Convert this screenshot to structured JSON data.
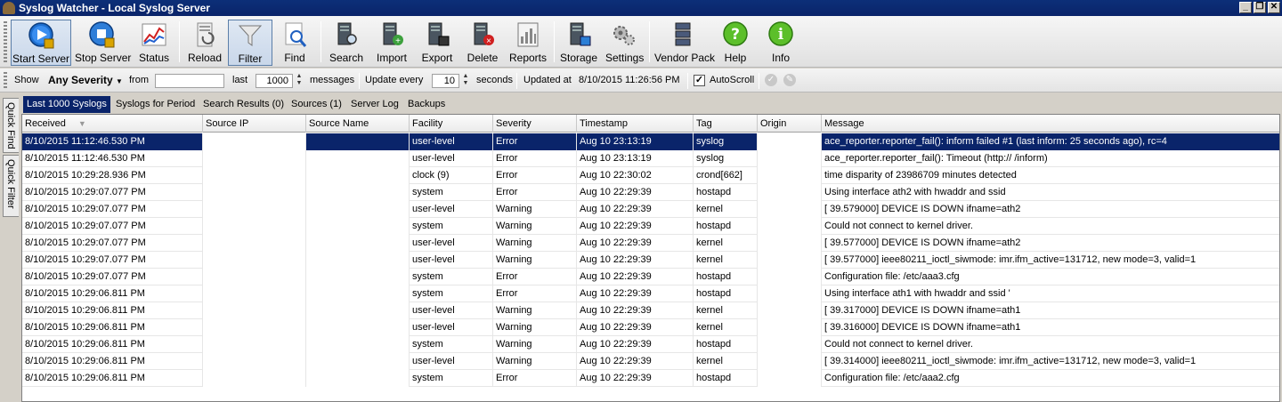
{
  "window": {
    "title": "Syslog Watcher - Local Syslog Server"
  },
  "toolbar": {
    "buttons": [
      {
        "label": "Start Server",
        "icon": "play-server-icon"
      },
      {
        "label": "Stop Server",
        "icon": "stop-server-icon"
      },
      {
        "label": "Status",
        "icon": "chart-icon"
      },
      {
        "label": "Reload",
        "icon": "reload-icon"
      },
      {
        "label": "Filter",
        "icon": "funnel-icon"
      },
      {
        "label": "Find",
        "icon": "find-icon"
      },
      {
        "label": "Search",
        "icon": "search-server-icon"
      },
      {
        "label": "Import",
        "icon": "import-icon"
      },
      {
        "label": "Export",
        "icon": "export-icon"
      },
      {
        "label": "Delete",
        "icon": "delete-icon"
      },
      {
        "label": "Reports",
        "icon": "reports-icon"
      },
      {
        "label": "Storage",
        "icon": "storage-icon"
      },
      {
        "label": "Settings",
        "icon": "gears-icon"
      },
      {
        "label": "Vendor Pack",
        "icon": "vendor-pack-icon"
      },
      {
        "label": "Help",
        "icon": "help-icon"
      },
      {
        "label": "Info",
        "icon": "info-icon"
      }
    ]
  },
  "options": {
    "show_label": "Show",
    "severity_value": "Any Severity",
    "from_label": "from",
    "from_value": "",
    "last_label": "last",
    "last_value": "1000",
    "messages_label": "messages",
    "update_label": "Update every",
    "update_value": "10",
    "seconds_label": "seconds",
    "updated_label": "Updated at",
    "updated_value": "8/10/2015 11:26:56 PM",
    "autoscroll_label": "AutoScroll",
    "autoscroll_checked": true
  },
  "sidetabs": [
    "Quick Find",
    "Quick Filter"
  ],
  "tabs": [
    "Last 1000 Syslogs",
    "Syslogs for Period",
    "Search Results (0)",
    "Sources (1)",
    "Server Log",
    "Backups"
  ],
  "active_tab": 0,
  "columns": [
    "Received",
    "Source IP",
    "Source Name",
    "Facility",
    "Severity",
    "Timestamp",
    "Tag",
    "Origin",
    "Message"
  ],
  "rows": [
    [
      "8/10/2015 11:12:46.530 PM",
      "",
      "",
      "user-level",
      "Error",
      "Aug 10 23:13:19",
      "syslog",
      "",
      "ace_reporter.reporter_fail(): inform failed #1 (last inform: 25 seconds ago), rc=4"
    ],
    [
      "8/10/2015 11:12:46.530 PM",
      "",
      "",
      "user-level",
      "Error",
      "Aug 10 23:13:19",
      "syslog",
      "",
      "ace_reporter.reporter_fail(): Timeout (http://                          /inform)"
    ],
    [
      "8/10/2015 10:29:28.936 PM",
      "",
      "",
      "clock (9)",
      "Error",
      "Aug 10 22:30:02",
      "crond[662]",
      "",
      "time disparity of 23986709 minutes detected"
    ],
    [
      "8/10/2015 10:29:07.077 PM",
      "",
      "",
      "system",
      "Error",
      "Aug 10 22:29:39",
      "hostapd",
      "",
      "Using interface ath2 with hwaddr                          and ssid"
    ],
    [
      "8/10/2015 10:29:07.077 PM",
      "",
      "",
      "user-level",
      "Warning",
      "Aug 10 22:29:39",
      "kernel",
      "",
      "[   39.579000]  DEVICE IS DOWN ifname=ath2"
    ],
    [
      "8/10/2015 10:29:07.077 PM",
      "",
      "",
      "system",
      "Warning",
      "Aug 10 22:29:39",
      "hostapd",
      "",
      "Could not connect to kernel driver."
    ],
    [
      "8/10/2015 10:29:07.077 PM",
      "",
      "",
      "user-level",
      "Warning",
      "Aug 10 22:29:39",
      "kernel",
      "",
      "[   39.577000]  DEVICE IS DOWN ifname=ath2"
    ],
    [
      "8/10/2015 10:29:07.077 PM",
      "",
      "",
      "user-level",
      "Warning",
      "Aug 10 22:29:39",
      "kernel",
      "",
      "[   39.577000]  ieee80211_ioctl_siwmode: imr.ifm_active=131712, new mode=3, valid=1"
    ],
    [
      "8/10/2015 10:29:07.077 PM",
      "",
      "",
      "system",
      "Error",
      "Aug 10 22:29:39",
      "hostapd",
      "",
      "Configuration file: /etc/aaa3.cfg"
    ],
    [
      "8/10/2015 10:29:06.811 PM",
      "",
      "",
      "system",
      "Error",
      "Aug 10 22:29:39",
      "hostapd",
      "",
      "Using interface ath1 with hwaddr                          and ssid '"
    ],
    [
      "8/10/2015 10:29:06.811 PM",
      "",
      "",
      "user-level",
      "Warning",
      "Aug 10 22:29:39",
      "kernel",
      "",
      "[   39.317000]  DEVICE IS DOWN ifname=ath1"
    ],
    [
      "8/10/2015 10:29:06.811 PM",
      "",
      "",
      "user-level",
      "Warning",
      "Aug 10 22:29:39",
      "kernel",
      "",
      "[   39.316000]  DEVICE IS DOWN ifname=ath1"
    ],
    [
      "8/10/2015 10:29:06.811 PM",
      "",
      "",
      "system",
      "Warning",
      "Aug 10 22:29:39",
      "hostapd",
      "",
      "Could not connect to kernel driver."
    ],
    [
      "8/10/2015 10:29:06.811 PM",
      "",
      "",
      "user-level",
      "Warning",
      "Aug 10 22:29:39",
      "kernel",
      "",
      "[   39.314000]  ieee80211_ioctl_siwmode: imr.ifm_active=131712, new mode=3, valid=1"
    ],
    [
      "8/10/2015 10:29:06.811 PM",
      "",
      "",
      "system",
      "Error",
      "Aug 10 22:29:39",
      "hostapd",
      "",
      "Configuration file: /etc/aaa2.cfg"
    ]
  ],
  "selected_row": 0,
  "colors": {
    "selection": "#0a246a",
    "title_bar": "#0a246a"
  }
}
